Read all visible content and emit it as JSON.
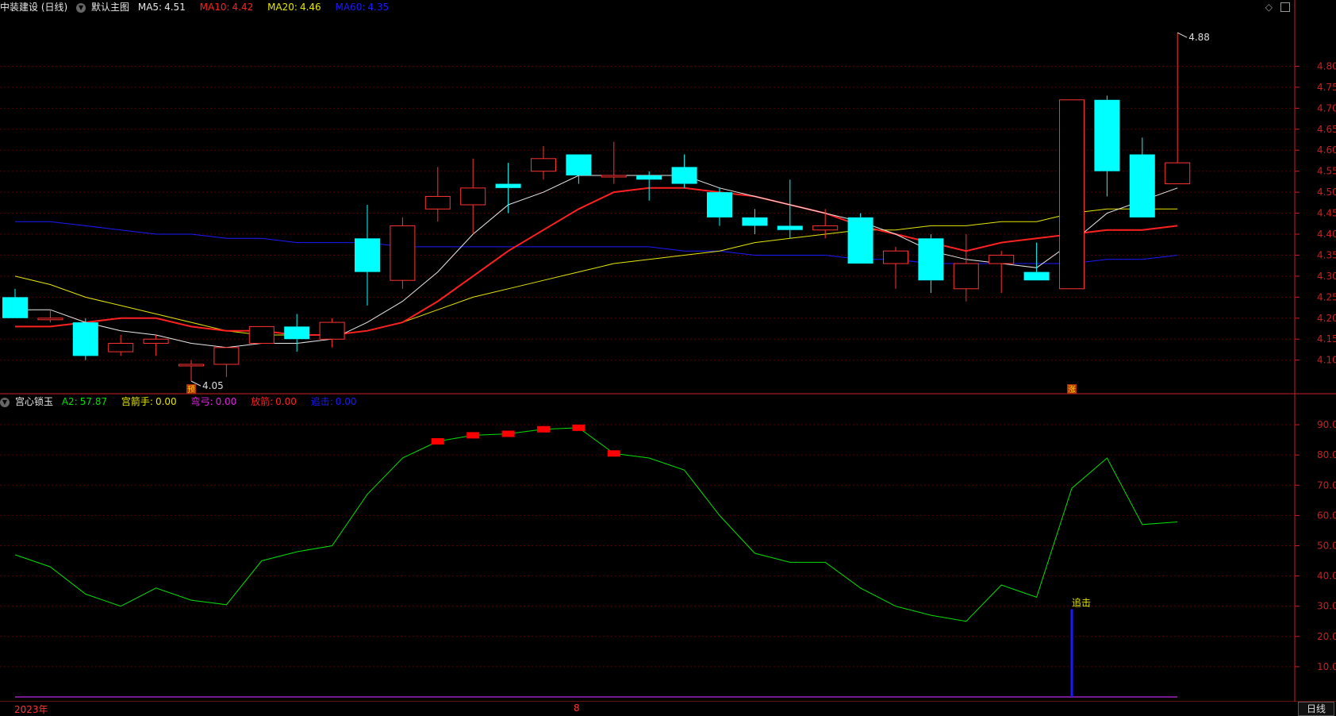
{
  "header": {
    "stock_name": "中装建设 (日线)",
    "template": "默认主图",
    "ma5_label": "MA5:",
    "ma5_value": "4.51",
    "ma10_label": "MA10:",
    "ma10_value": "4.42",
    "ma20_label": "MA20:",
    "ma20_value": "4.46",
    "ma60_label": "MA60:",
    "ma60_value": "4.35"
  },
  "indicator_header": {
    "name": "宫心锁玉",
    "a2_label": "A2:",
    "a2_value": "57.87",
    "s1_label": "宫箭手:",
    "s1_value": "0.00",
    "s2_label": "弯弓:",
    "s2_value": "0.00",
    "s3_label": "放箭:",
    "s3_value": "0.00",
    "s4_label": "追击:",
    "s4_value": "0.00"
  },
  "footer": {
    "year_label": "2023年",
    "month_label": "8",
    "period_button": "日线"
  },
  "colors": {
    "up": "#ff3232",
    "down": "#00ffff",
    "ma5": "#e8e8e8",
    "ma10": "#ff2020",
    "ma20": "#e6e600",
    "ma60": "#1a1aff",
    "a2": "#00e000",
    "grid": "#5a0000",
    "axis": "#cc2020"
  },
  "chart_data": [
    {
      "type": "candlestick",
      "title": "中装建设 (日线)",
      "ylim": [
        4.02,
        4.92
      ],
      "yticks": [
        "4.80",
        "4.75",
        "4.70",
        "4.65",
        "4.60",
        "4.55",
        "4.50",
        "4.45",
        "4.40",
        "4.35",
        "4.30",
        "4.25",
        "4.20",
        "4.15",
        "4.10"
      ],
      "candles": [
        {
          "o": 4.25,
          "h": 4.27,
          "l": 4.2,
          "c": 4.2
        },
        {
          "o": 4.2,
          "h": 4.22,
          "l": 4.19,
          "c": 4.2
        },
        {
          "o": 4.19,
          "h": 4.2,
          "l": 4.1,
          "c": 4.11
        },
        {
          "o": 4.12,
          "h": 4.16,
          "l": 4.11,
          "c": 4.14
        },
        {
          "o": 4.14,
          "h": 4.16,
          "l": 4.11,
          "c": 4.15
        },
        {
          "o": 4.09,
          "h": 4.1,
          "l": 4.05,
          "c": 4.09
        },
        {
          "o": 4.09,
          "h": 4.13,
          "l": 4.06,
          "c": 4.13
        },
        {
          "o": 4.14,
          "h": 4.18,
          "l": 4.14,
          "c": 4.18
        },
        {
          "o": 4.18,
          "h": 4.21,
          "l": 4.12,
          "c": 4.15
        },
        {
          "o": 4.15,
          "h": 4.2,
          "l": 4.13,
          "c": 4.19
        },
        {
          "o": 4.39,
          "h": 4.47,
          "l": 4.23,
          "c": 4.31
        },
        {
          "o": 4.29,
          "h": 4.44,
          "l": 4.27,
          "c": 4.42
        },
        {
          "o": 4.46,
          "h": 4.56,
          "l": 4.43,
          "c": 4.49
        },
        {
          "o": 4.47,
          "h": 4.58,
          "l": 4.4,
          "c": 4.51
        },
        {
          "o": 4.52,
          "h": 4.57,
          "l": 4.45,
          "c": 4.51
        },
        {
          "o": 4.55,
          "h": 4.61,
          "l": 4.53,
          "c": 4.58
        },
        {
          "o": 4.59,
          "h": 4.59,
          "l": 4.52,
          "c": 4.54
        },
        {
          "o": 4.54,
          "h": 4.62,
          "l": 4.52,
          "c": 4.54
        },
        {
          "o": 4.54,
          "h": 4.55,
          "l": 4.48,
          "c": 4.53
        },
        {
          "o": 4.56,
          "h": 4.59,
          "l": 4.51,
          "c": 4.52
        },
        {
          "o": 4.5,
          "h": 4.51,
          "l": 4.42,
          "c": 4.44
        },
        {
          "o": 4.44,
          "h": 4.46,
          "l": 4.4,
          "c": 4.42
        },
        {
          "o": 4.42,
          "h": 4.53,
          "l": 4.39,
          "c": 4.41
        },
        {
          "o": 4.41,
          "h": 4.46,
          "l": 4.39,
          "c": 4.42
        },
        {
          "o": 4.44,
          "h": 4.45,
          "l": 4.33,
          "c": 4.33
        },
        {
          "o": 4.33,
          "h": 4.37,
          "l": 4.27,
          "c": 4.36
        },
        {
          "o": 4.39,
          "h": 4.4,
          "l": 4.26,
          "c": 4.29
        },
        {
          "o": 4.27,
          "h": 4.4,
          "l": 4.24,
          "c": 4.33
        },
        {
          "o": 4.33,
          "h": 4.36,
          "l": 4.26,
          "c": 4.35
        },
        {
          "o": 4.31,
          "h": 4.38,
          "l": 4.29,
          "c": 4.29
        },
        {
          "o": 4.27,
          "h": 4.72,
          "l": 4.27,
          "c": 4.72
        },
        {
          "o": 4.72,
          "h": 4.73,
          "l": 4.49,
          "c": 4.55
        },
        {
          "o": 4.59,
          "h": 4.63,
          "l": 4.44,
          "c": 4.44
        },
        {
          "o": 4.52,
          "h": 4.88,
          "l": 4.52,
          "c": 4.57
        }
      ],
      "ma5": [
        4.22,
        4.22,
        4.19,
        4.17,
        4.16,
        4.14,
        4.13,
        4.14,
        4.14,
        4.15,
        4.19,
        4.24,
        4.31,
        4.4,
        4.47,
        4.5,
        4.54,
        4.54,
        4.54,
        4.54,
        4.51,
        4.49,
        4.47,
        4.45,
        4.43,
        4.4,
        4.36,
        4.34,
        4.33,
        4.32,
        4.38,
        4.45,
        4.48,
        4.51
      ],
      "ma10": [
        4.18,
        4.18,
        4.19,
        4.2,
        4.2,
        4.18,
        4.17,
        4.17,
        4.16,
        4.16,
        4.17,
        4.19,
        4.24,
        4.3,
        4.36,
        4.41,
        4.46,
        4.5,
        4.51,
        4.51,
        4.5,
        4.49,
        4.47,
        4.45,
        4.42,
        4.4,
        4.38,
        4.36,
        4.38,
        4.39,
        4.4,
        4.41,
        4.41,
        4.42
      ],
      "ma20": [
        4.3,
        4.28,
        4.25,
        4.23,
        4.21,
        4.19,
        4.17,
        4.16,
        4.16,
        4.16,
        4.17,
        4.19,
        4.22,
        4.25,
        4.27,
        4.29,
        4.31,
        4.33,
        4.34,
        4.35,
        4.36,
        4.38,
        4.39,
        4.4,
        4.41,
        4.41,
        4.42,
        4.42,
        4.43,
        4.43,
        4.45,
        4.46,
        4.46,
        4.46
      ],
      "ma60": [
        4.43,
        4.43,
        4.42,
        4.41,
        4.4,
        4.4,
        4.39,
        4.39,
        4.38,
        4.38,
        4.38,
        4.37,
        4.37,
        4.37,
        4.37,
        4.37,
        4.37,
        4.37,
        4.37,
        4.36,
        4.36,
        4.35,
        4.35,
        4.35,
        4.34,
        4.34,
        4.33,
        4.33,
        4.33,
        4.33,
        4.33,
        4.34,
        4.34,
        4.35
      ],
      "annotations": [
        {
          "label": "4.88",
          "type": "high"
        },
        {
          "label": "4.05",
          "type": "low"
        }
      ],
      "markers": [
        {
          "index": 5,
          "text": "预"
        },
        {
          "index": 30,
          "text": "涨"
        }
      ]
    },
    {
      "type": "line",
      "title": "宫心锁玉",
      "ylim": [
        0,
        95
      ],
      "yticks": [
        "90.00",
        "80.00",
        "70.00",
        "60.00",
        "50.00",
        "40.00",
        "30.00",
        "20.00",
        "10.00"
      ],
      "series": [
        {
          "name": "A2",
          "values": [
            47,
            43,
            34,
            30,
            36,
            32,
            30.5,
            45,
            48,
            50,
            67,
            79,
            84.5,
            86.5,
            87,
            88.5,
            89,
            80.5,
            79,
            75,
            60,
            47.5,
            44.5,
            44.5,
            36,
            30,
            27,
            25,
            37,
            33,
            69,
            79,
            57,
            57.87
          ]
        }
      ],
      "signal_boxes": [
        12,
        13,
        14,
        15,
        16,
        17
      ],
      "bars": [
        {
          "index": 30,
          "value": 29,
          "label": "追击"
        }
      ]
    }
  ]
}
